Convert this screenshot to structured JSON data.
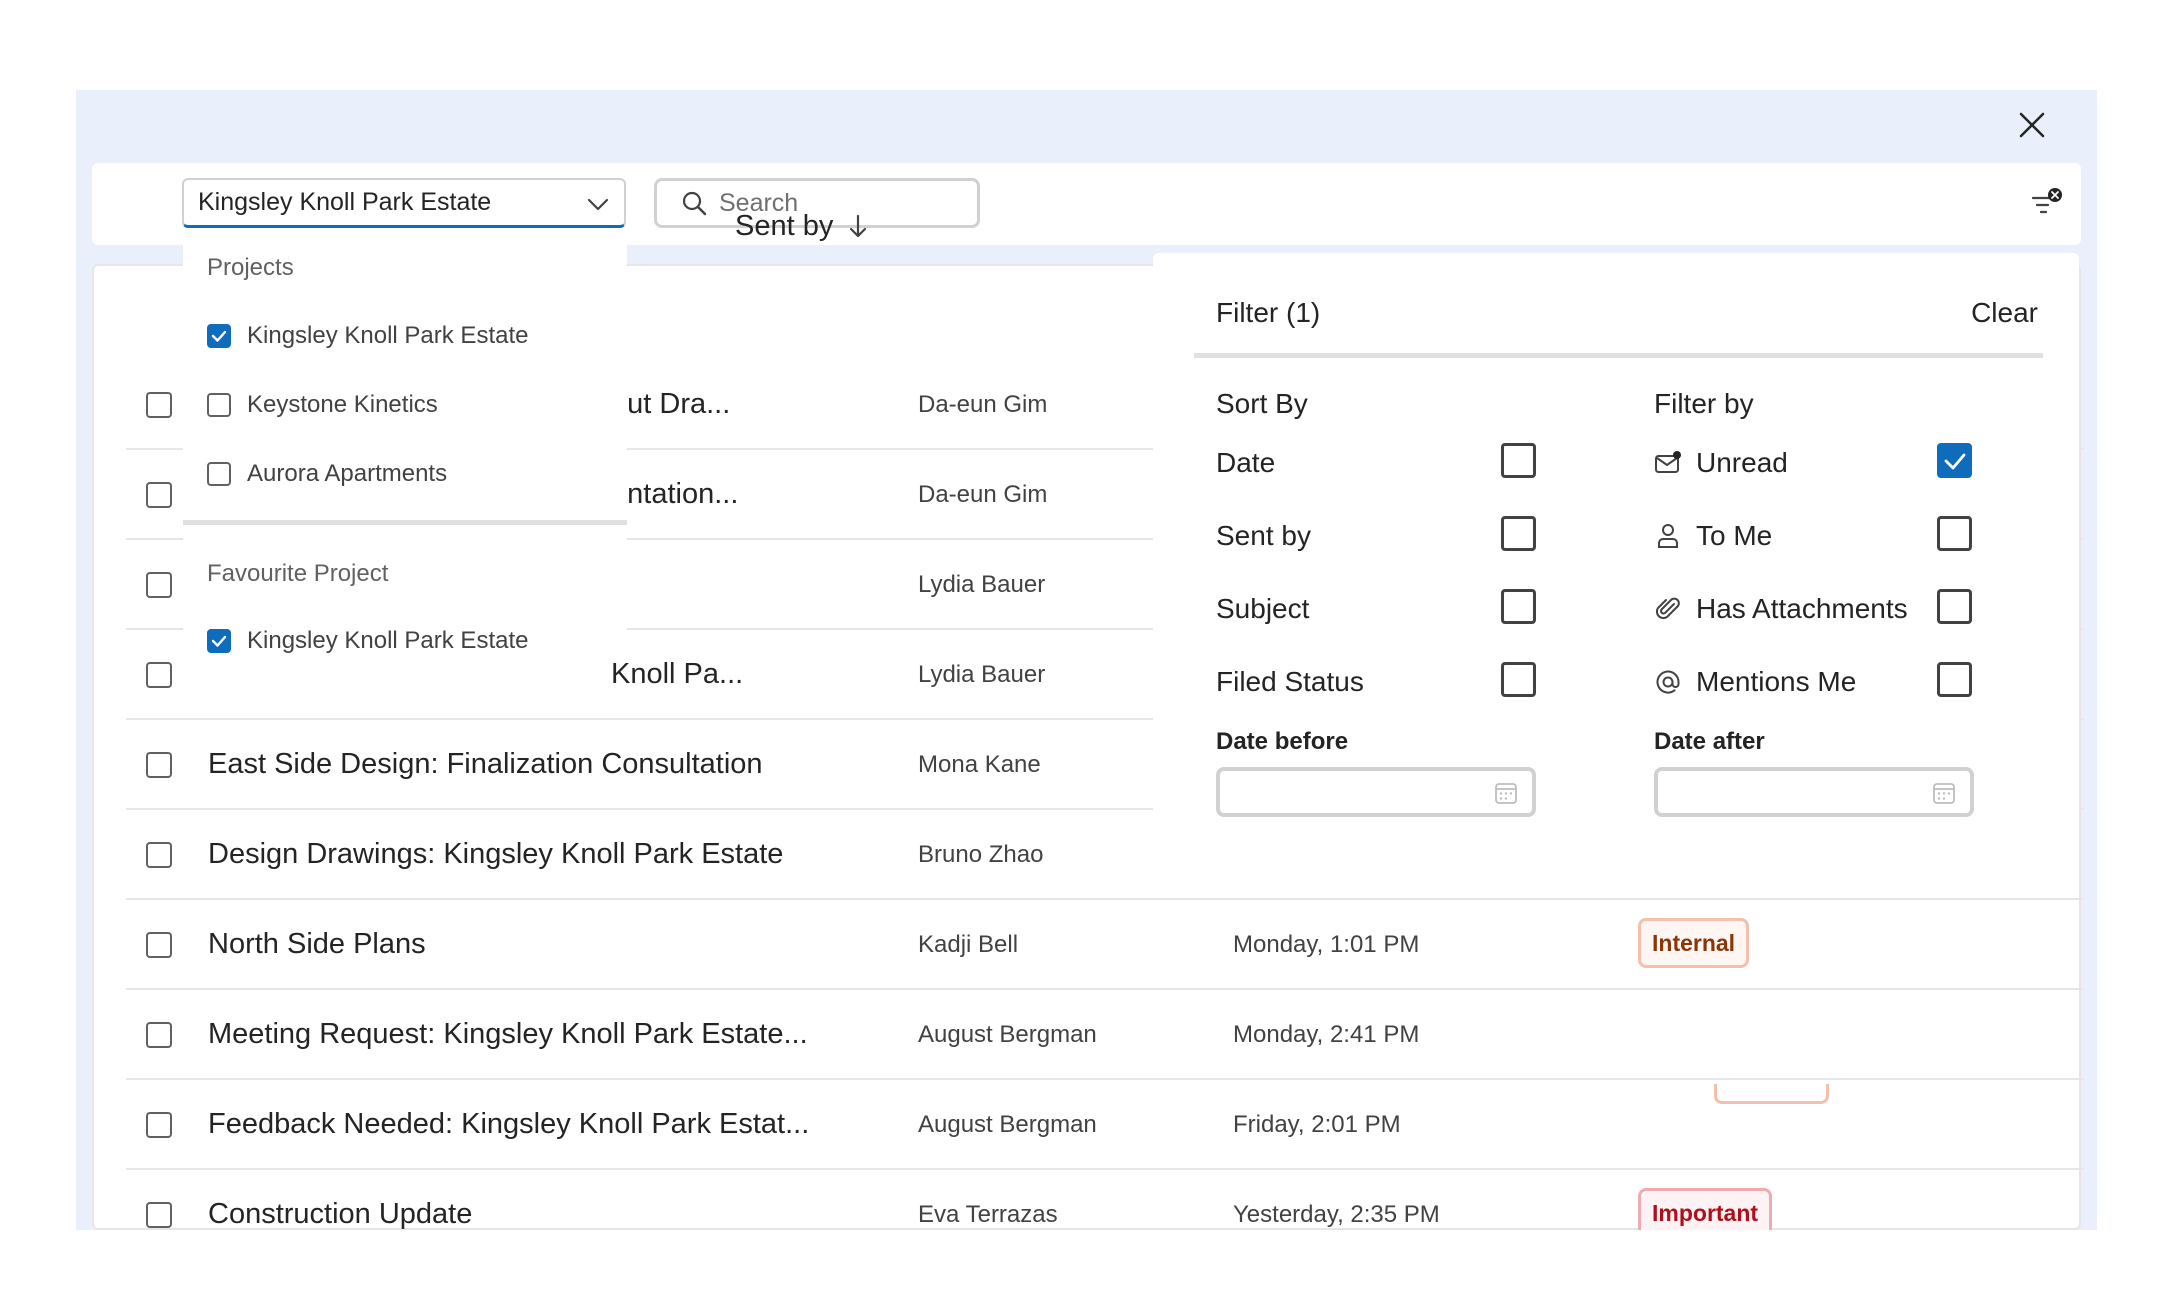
{
  "toolbar": {
    "project_selected": "Kingsley Knoll Park Estate",
    "search_placeholder": "Search"
  },
  "list": {
    "sent_by_header": "Sent by",
    "rows": [
      {
        "subject": "out Dra...",
        "sender": "Da-eun Gim",
        "date": "",
        "tag": ""
      },
      {
        "subject": "entation...",
        "sender": "Da-eun Gim",
        "date": "",
        "tag": ""
      },
      {
        "subject": "",
        "sender": "Lydia Bauer",
        "date": "",
        "tag": ""
      },
      {
        "subject": "Knoll Pa...",
        "sender": "Lydia Bauer",
        "date": "",
        "tag": ""
      },
      {
        "subject": "East Side Design: Finalization Consultation",
        "sender": "Mona Kane",
        "date": "",
        "tag": ""
      },
      {
        "subject": "Design Drawings: Kingsley Knoll Park Estate",
        "sender": "Bruno Zhao",
        "date": "",
        "tag": ""
      },
      {
        "subject": "North Side Plans",
        "sender": "Kadji Bell",
        "date": "Monday, 1:01 PM",
        "tag": "Internal"
      },
      {
        "subject": "Meeting Request: Kingsley Knoll Park Estate...",
        "sender": "August Bergman",
        "date": "Monday, 2:41 PM",
        "tag": ""
      },
      {
        "subject": "Feedback Needed: Kingsley Knoll Park Estat...",
        "sender": "August Bergman",
        "date": "Friday, 2:01 PM",
        "tag": ""
      },
      {
        "subject": "Construction Update",
        "sender": "Eva Terrazas",
        "date": "Yesterday, 2:35 PM",
        "tag": "Important"
      }
    ]
  },
  "dropdown": {
    "projects_header": "Projects",
    "projects": [
      {
        "label": "Kingsley Knoll Park Estate",
        "checked": true
      },
      {
        "label": "Keystone Kinetics",
        "checked": false
      },
      {
        "label": "Aurora Apartments",
        "checked": false
      }
    ],
    "favourite_header": "Favourite Project",
    "favourites": [
      {
        "label": "Kingsley Knoll Park Estate",
        "checked": true
      }
    ]
  },
  "filter": {
    "title": "Filter (1)",
    "clear": "Clear",
    "sort_header": "Sort By",
    "sort_options": [
      {
        "label": "Date",
        "checked": false
      },
      {
        "label": "Sent by",
        "checked": false
      },
      {
        "label": "Subject",
        "checked": false
      },
      {
        "label": "Filed Status",
        "checked": false
      }
    ],
    "filter_header": "Filter by",
    "filter_options": [
      {
        "label": "Unread",
        "icon": "mail-unread-icon",
        "checked": true
      },
      {
        "label": "To Me",
        "icon": "person-icon",
        "checked": false
      },
      {
        "label": "Has Attachments",
        "icon": "paperclip-icon",
        "checked": false
      },
      {
        "label": "Mentions Me",
        "icon": "mention-icon",
        "checked": false
      }
    ],
    "date_before_label": "Date before",
    "date_after_label": "Date after",
    "date_before_value": "",
    "date_after_value": ""
  },
  "colors": {
    "accent": "#0f6cbd",
    "window_bg": "#eaf0fb",
    "internal_tag": "#8a3707",
    "important_tag": "#b10e1c"
  }
}
